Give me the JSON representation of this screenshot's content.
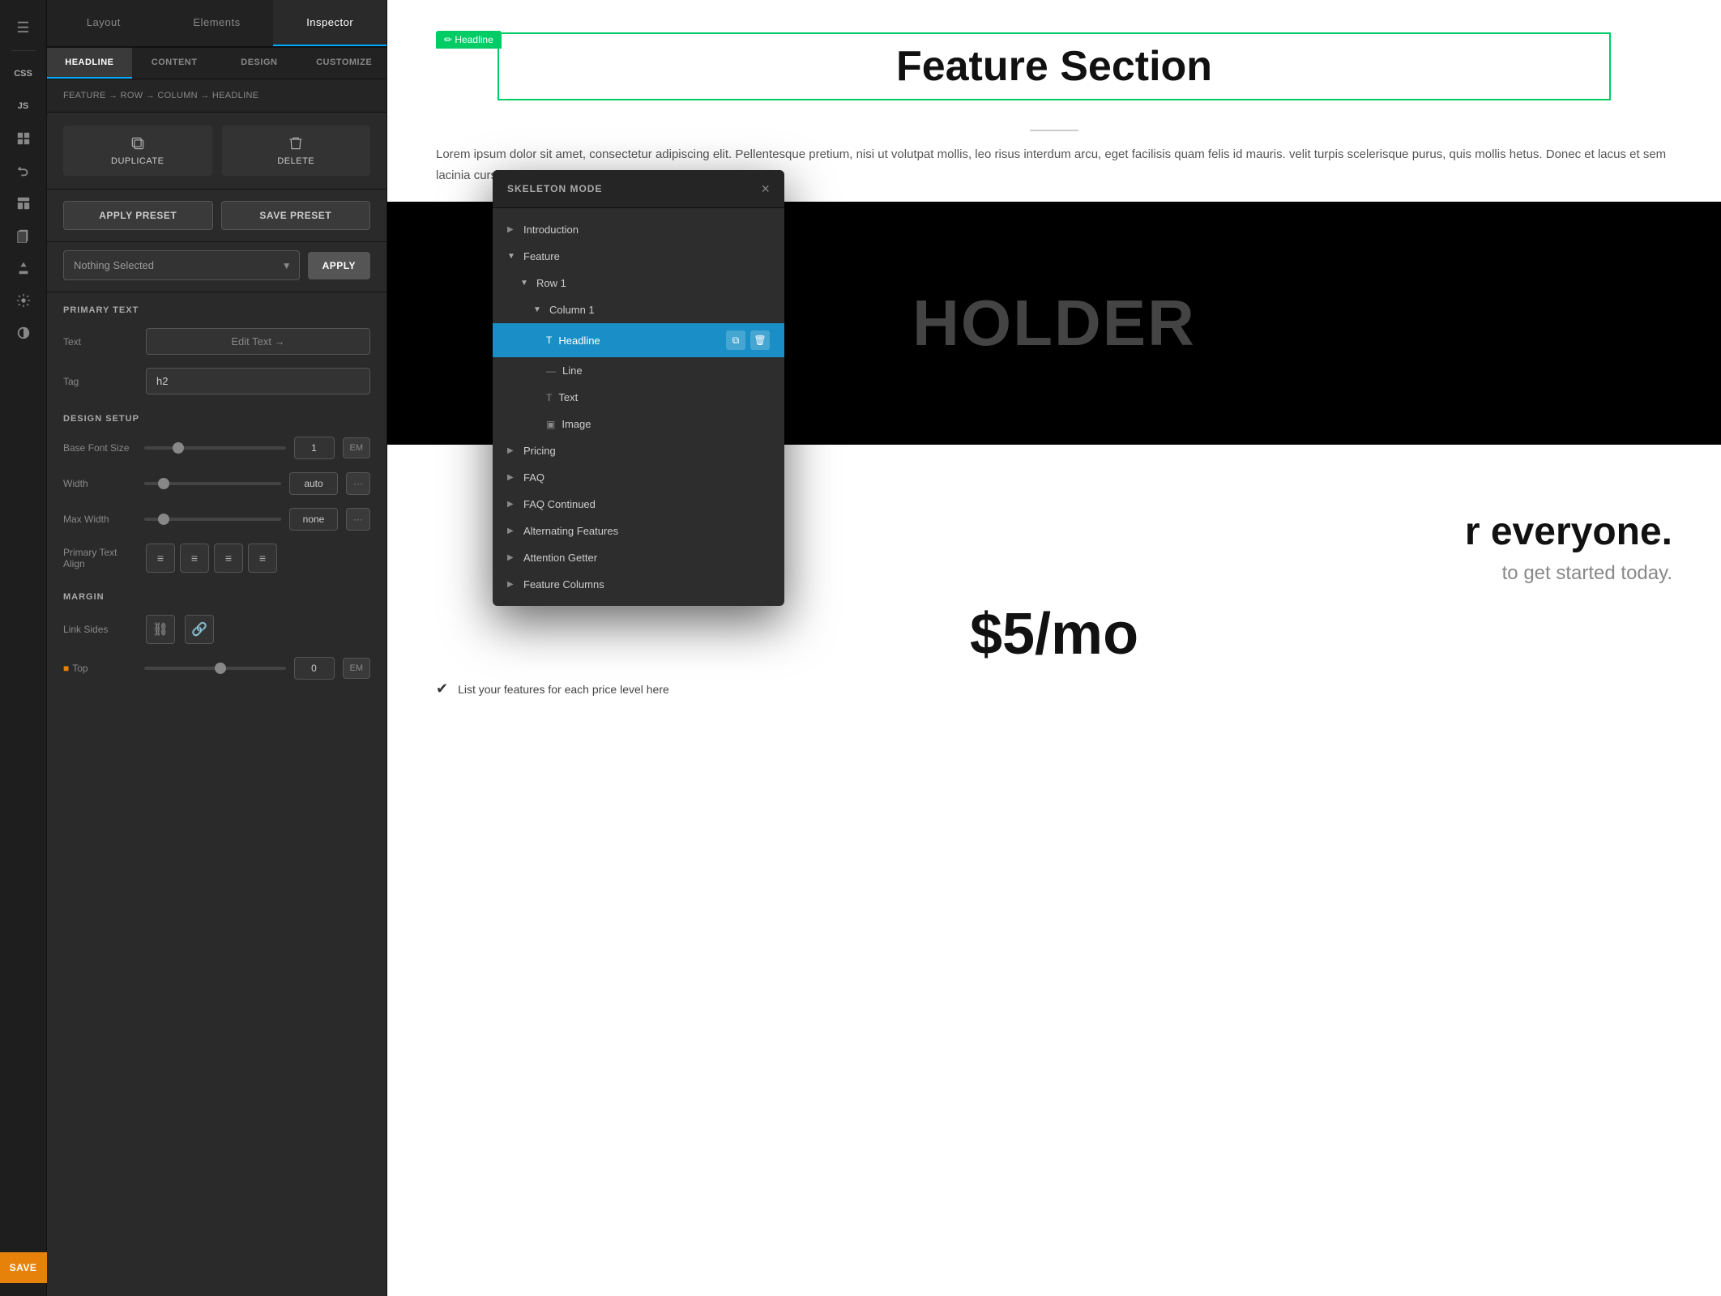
{
  "app": {
    "title": "Inspector"
  },
  "topTabs": {
    "tabs": [
      {
        "label": "Layout",
        "active": false
      },
      {
        "label": "Elements",
        "active": false
      },
      {
        "label": "Inspector",
        "active": true
      }
    ]
  },
  "subTabs": {
    "tabs": [
      {
        "label": "HEADLINE",
        "active": true
      },
      {
        "label": "CONTENT",
        "active": false
      },
      {
        "label": "DESIGN",
        "active": false
      },
      {
        "label": "CUSTOMIZE",
        "active": false
      }
    ]
  },
  "breadcrumb": {
    "text": "FEATURE → ROW → COLUMN → HEADLINE"
  },
  "actions": {
    "duplicate": "DUPLICATE",
    "delete": "DELETE"
  },
  "presets": {
    "apply": "APPLY PRESET",
    "save": "SAVE PRESET"
  },
  "selectRow": {
    "placeholder": "Nothing Selected",
    "applyBtn": "APPLY"
  },
  "primaryText": {
    "sectionLabel": "PRIMARY TEXT",
    "textLabel": "Text",
    "textPlaceholder": "Edit Text →",
    "tagLabel": "Tag",
    "tagValue": "h2"
  },
  "designSetup": {
    "sectionLabel": "DESIGN SETUP",
    "baseFontLabel": "Base Font Size",
    "baseFontValue": "1",
    "baseFontUnit": "EM",
    "widthLabel": "Width",
    "widthValue": "auto",
    "maxWidthLabel": "Max Width",
    "maxWidthValue": "none",
    "alignLabel": "Primary Text Align"
  },
  "margin": {
    "sectionLabel": "MARGIN",
    "linkSidesLabel": "Link Sides",
    "topLabel": "Top",
    "topValue": "0",
    "topUnit": "EM"
  },
  "skeletonMode": {
    "title": "SKELETON MODE",
    "closeLabel": "×",
    "treeItems": [
      {
        "label": "Introduction",
        "level": 0,
        "hasArrow": true,
        "arrowOpen": false,
        "icon": null,
        "active": false
      },
      {
        "label": "Feature",
        "level": 0,
        "hasArrow": true,
        "arrowOpen": true,
        "icon": null,
        "active": false
      },
      {
        "label": "Row 1",
        "level": 1,
        "hasArrow": true,
        "arrowOpen": true,
        "icon": null,
        "active": false
      },
      {
        "label": "Column 1",
        "level": 2,
        "hasArrow": true,
        "arrowOpen": true,
        "icon": null,
        "active": false
      },
      {
        "label": "Headline",
        "level": 3,
        "hasArrow": false,
        "arrowOpen": false,
        "icon": "T",
        "active": true
      },
      {
        "label": "Line",
        "level": 3,
        "hasArrow": false,
        "arrowOpen": false,
        "icon": "—",
        "active": false
      },
      {
        "label": "Text",
        "level": 3,
        "hasArrow": false,
        "arrowOpen": false,
        "icon": "T",
        "active": false
      },
      {
        "label": "Image",
        "level": 3,
        "hasArrow": false,
        "arrowOpen": false,
        "icon": "🖼",
        "active": false
      },
      {
        "label": "Pricing",
        "level": 0,
        "hasArrow": true,
        "arrowOpen": false,
        "icon": null,
        "active": false
      },
      {
        "label": "FAQ",
        "level": 0,
        "hasArrow": true,
        "arrowOpen": false,
        "icon": null,
        "active": false
      },
      {
        "label": "FAQ Continued",
        "level": 0,
        "hasArrow": true,
        "arrowOpen": false,
        "icon": null,
        "active": false
      },
      {
        "label": "Alternating Features",
        "level": 0,
        "hasArrow": true,
        "arrowOpen": false,
        "icon": null,
        "active": false
      },
      {
        "label": "Attention Getter",
        "level": 0,
        "hasArrow": true,
        "arrowOpen": false,
        "icon": null,
        "active": false
      },
      {
        "label": "Feature Columns",
        "level": 0,
        "hasArrow": true,
        "arrowOpen": false,
        "icon": null,
        "active": false
      }
    ]
  },
  "canvas": {
    "headlineTag": "✏ Headline",
    "featureTitle": "Feature Section",
    "loremText": "Lorem ipsum dolor sit amet, consectetur adipiscing elit. Pellentesque pretium, nisi ut volutpat mollis, leo risus interdum arcu, eget facilisis quam felis id mauris. velit turpis scelerisque purus, quis mollis hetus. Donec et lacus et sem lacinia cursus.",
    "placeholderText": "HOLDER",
    "pricingSubtitle": "r everyone.",
    "pricingCta": "to get started today.",
    "pricingPrice": "$5/mo",
    "pricingFeature": "List your features for each price level here"
  },
  "saveBtn": "SAVE",
  "iconSidebar": {
    "cssLabel": "CSS",
    "jsLabel": "JS"
  }
}
